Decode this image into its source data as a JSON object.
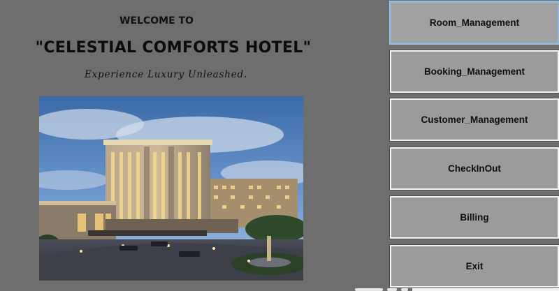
{
  "header": {
    "welcome": "WELCOME TO",
    "hotel_name": "\"CELESTIAL COMFORTS HOTEL\"",
    "tagline": "Experience Luxury Unleashed."
  },
  "photo": {
    "subject": "hotel-building-dusk"
  },
  "nav": {
    "room_management": "Room_Management",
    "booking_management": "Booking_Management",
    "customer_management": "Customer_Management",
    "checkinout": "CheckInOut",
    "billing": "Billing",
    "exit": "Exit"
  },
  "colors": {
    "background": "#6e6e6e",
    "button_face": "#9b9b9b",
    "button_border": "#f2f2f2",
    "active_border": "#8fb3d9"
  }
}
